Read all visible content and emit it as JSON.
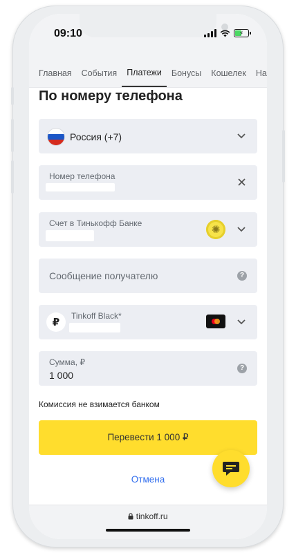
{
  "status_bar": {
    "time": "09:10"
  },
  "tabs": [
    {
      "label": "Главная",
      "active": false
    },
    {
      "label": "События",
      "active": false
    },
    {
      "label": "Платежи",
      "active": true
    },
    {
      "label": "Бонусы",
      "active": false
    },
    {
      "label": "Кошелек",
      "active": false
    },
    {
      "label": "Настро",
      "active": false
    }
  ],
  "page": {
    "title": "По номеру телефона"
  },
  "form": {
    "country": {
      "value": "Россия (+7)",
      "icon": "russia-flag-icon"
    },
    "phone": {
      "label": "Номер телефона"
    },
    "account": {
      "label": "Счет в Тинькофф Банке"
    },
    "message": {
      "placeholder": "Сообщение получателю"
    },
    "source_card": {
      "label": "Tinkoff Black*",
      "currency_symbol": "₽"
    },
    "amount": {
      "label": "Сумма, ₽",
      "value": "1 000"
    }
  },
  "commission_text": "Комиссия не взимается банком",
  "pay_button": {
    "label": "Перевести 1 000 ₽"
  },
  "cancel_link": {
    "label": "Отмена"
  },
  "browser": {
    "url": "tinkoff.ru"
  },
  "colors": {
    "accent_yellow": "#ffdd2d",
    "link_blue": "#336fee",
    "field_bg": "#eceef3"
  }
}
